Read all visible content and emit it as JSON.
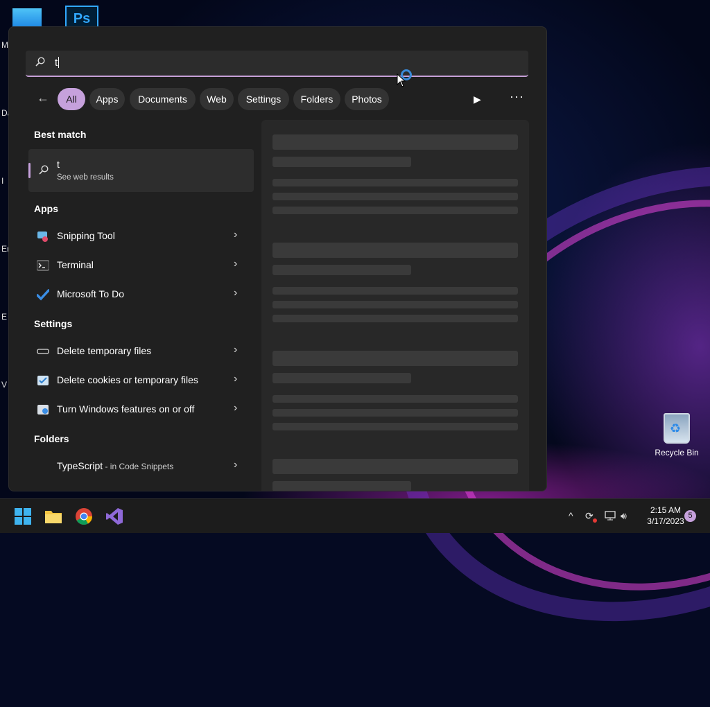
{
  "desktop": {
    "edge_letters": [
      "M",
      "Da",
      "I",
      "Er",
      "E",
      "V"
    ],
    "recycle_bin_label": "Recycle Bin"
  },
  "search": {
    "value": "t"
  },
  "filters": [
    "All",
    "Apps",
    "Documents",
    "Web",
    "Settings",
    "Folders",
    "Photos"
  ],
  "best_match": {
    "heading": "Best match",
    "title": "t",
    "subtitle": "See web results"
  },
  "apps": {
    "heading": "Apps",
    "items": [
      "Snipping Tool",
      "Terminal",
      "Microsoft To Do"
    ]
  },
  "settings": {
    "heading": "Settings",
    "items": [
      "Delete temporary files",
      "Delete cookies or temporary files",
      "Turn Windows features on or off"
    ]
  },
  "folders": {
    "heading": "Folders",
    "items": [
      {
        "name": "TypeScript",
        "location": " - in Code Snippets"
      }
    ]
  },
  "taskbar": {
    "apps": [
      "start-icon",
      "file-explorer-icon",
      "chrome-icon",
      "visual-studio-icon"
    ],
    "time": "2:15 AM",
    "date": "3/17/2023",
    "notification_count": "5"
  },
  "colors": {
    "accent": "#c6a1dc",
    "panel": "#202020",
    "taskbar": "#1c1c1c"
  }
}
